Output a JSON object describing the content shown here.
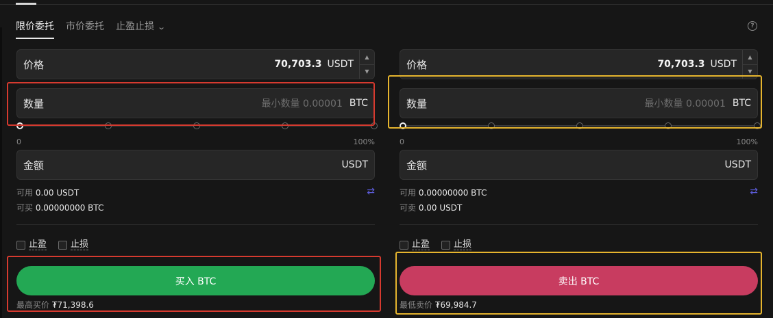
{
  "tabs": [
    {
      "label": "限价委托"
    },
    {
      "label": "市价委托"
    },
    {
      "label": "止盈止损"
    }
  ],
  "colors": {
    "buy": "#23a854",
    "sell": "#c83c60",
    "highlight_buy": "#d63a2f",
    "highlight_sell": "#e6b52e",
    "swap_icon": "#5b5bd6"
  },
  "icons": {
    "help": "help-circle-icon",
    "swap": "swap-arrows-icon",
    "dropdown": "chevron-down-icon",
    "stepper": "up-down-arrows-icon"
  },
  "buy": {
    "price_label": "价格",
    "price_value": "70,703.3",
    "price_unit": "USDT",
    "qty_label": "数量",
    "qty_placeholder": "最小数量 0.00001",
    "qty_unit": "BTC",
    "slider_min": "0",
    "slider_max": "100%",
    "slider_value": 0,
    "amount_label": "金额",
    "amount_unit": "USDT",
    "avail_label": "可用",
    "avail_value": "0.00 USDT",
    "can_label": "可买",
    "can_value": "0.00000000 BTC",
    "tp_label": "止盈",
    "sl_label": "止损",
    "button": "买入 BTC",
    "best_label": "最高买价",
    "best_value": "₮71,398.6"
  },
  "sell": {
    "price_label": "价格",
    "price_value": "70,703.3",
    "price_unit": "USDT",
    "qty_label": "数量",
    "qty_placeholder": "最小数量 0.00001",
    "qty_unit": "BTC",
    "slider_min": "0",
    "slider_max": "100%",
    "slider_value": 0,
    "amount_label": "金额",
    "amount_unit": "USDT",
    "avail_label": "可用",
    "avail_value": "0.00000000 BTC",
    "can_label": "可卖",
    "can_value": "0.00 USDT",
    "tp_label": "止盈",
    "sl_label": "止损",
    "button": "卖出 BTC",
    "best_label": "最低卖价",
    "best_value": "₮69,984.7"
  }
}
